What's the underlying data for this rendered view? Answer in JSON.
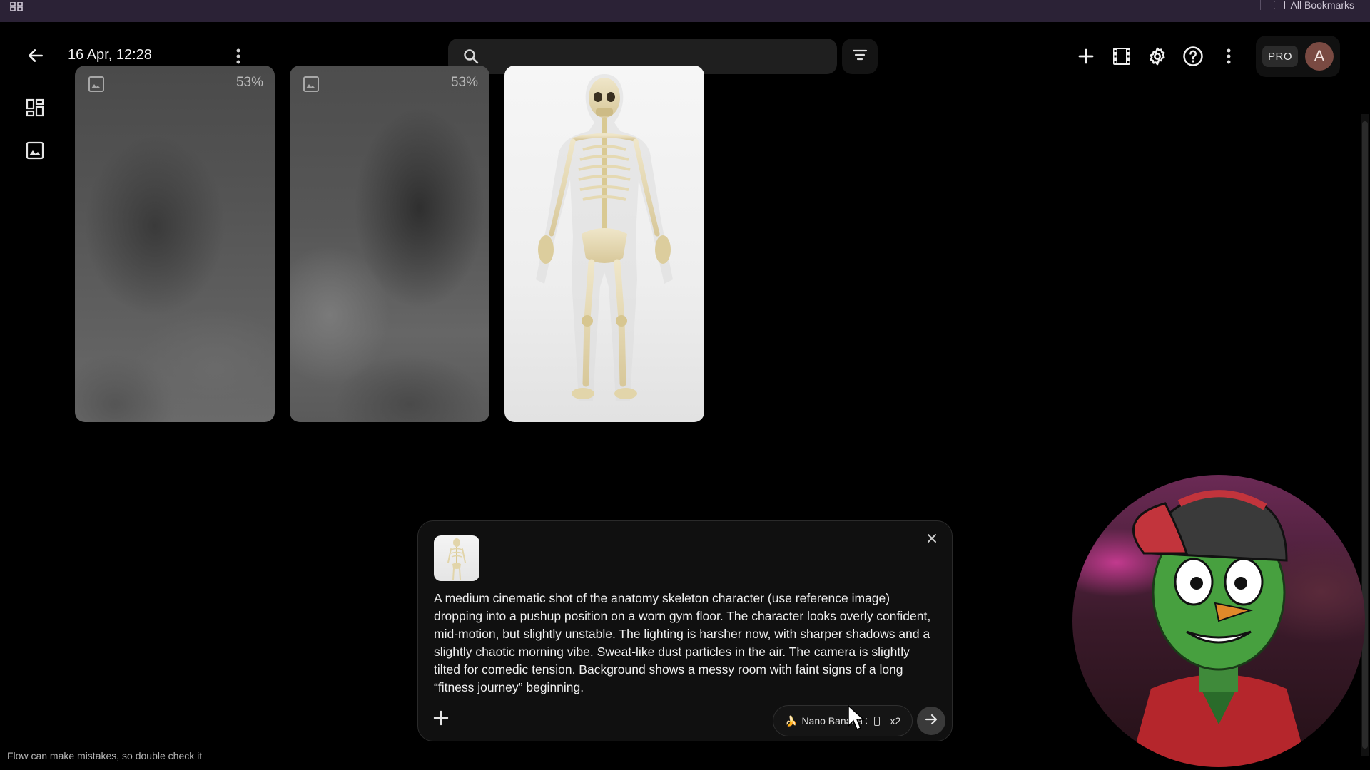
{
  "browser": {
    "bookmarks_label": "All Bookmarks"
  },
  "header": {
    "date_title": "16 Apr, 12:28",
    "search_placeholder": "",
    "pro_label": "PRO",
    "avatar_initial": "A"
  },
  "gallery": {
    "cards": [
      {
        "kind": "generating",
        "progress_label": "53%"
      },
      {
        "kind": "generating",
        "progress_label": "53%"
      },
      {
        "kind": "image",
        "subject": "skeleton"
      }
    ]
  },
  "prompt": {
    "text": "A medium cinematic shot of the anatomy skeleton character (use reference image) dropping into a pushup position on a worn gym floor. The character looks overly confident, mid-motion, but slightly unstable. The lighting is harsher now, with sharper shadows and a slightly chaotic morning vibe. Sweat-like dust particles in the air. The camera is slightly tilted for comedic tension. Background shows a messy room with faint signs of a long “fitness journey” beginning.",
    "model_label": "Nano Banana 2",
    "count_label": "x2"
  },
  "footer": {
    "disclaimer": "Flow can make mistakes, so double check it"
  },
  "colors": {
    "background": "#000000",
    "browser_bar": "#2b2236",
    "panel": "#101010",
    "avatar": "#7a4a42"
  }
}
